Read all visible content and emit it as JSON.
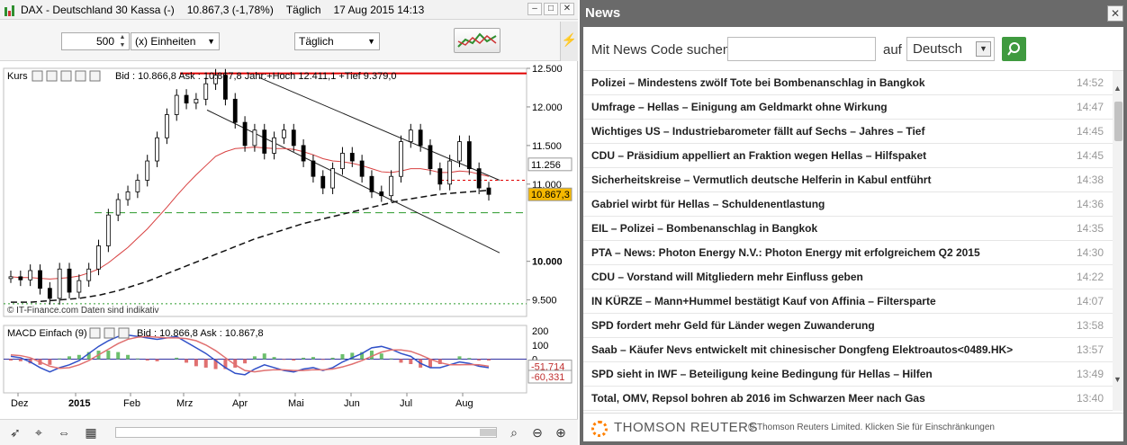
{
  "chart_window": {
    "title": "DAX - Deutschland 30 Kassa (-)",
    "last": "10.867,3 (-1,78%)",
    "interval": "Täglich",
    "datetime": "17 Aug 2015 14:13",
    "toolbar": {
      "quantity": "500",
      "unit": "(x) Einheiten",
      "period": "Täglich"
    },
    "icons": [
      "cursor-icon",
      "crosshair-icon",
      "pan-icon",
      "zoom-icon",
      "zoom-out-icon",
      "zoom-in-icon",
      "fit-icon"
    ],
    "colors": {
      "support": "#e00000",
      "ma_red": "#d84040",
      "channel": "#202020",
      "dashed_green": "#2a9a2a",
      "price_tag": "#f5b800"
    }
  },
  "chart_data": [
    {
      "type": "line",
      "title": "Kurs",
      "legend_text": "Bid : 10.866,8 Ask : 10.867,8 Jahr:+Hoch 12.411,1 +Tief 9.379,0",
      "credit": "© IT-Finance.com  Daten sind indikativ",
      "ylabels": [
        "12.500",
        "12.000",
        "11.500",
        "11.000",
        "10.000",
        "9.500"
      ],
      "ylim": [
        9379,
        12500
      ],
      "tags": [
        "11.256",
        "10.867,3"
      ],
      "xlabels": [
        "Dez",
        "2015",
        "Feb",
        "Mrz",
        "Apr",
        "Mai",
        "Jun",
        "Jul",
        "Aug"
      ],
      "year_high": 12411.1,
      "year_low": 9379.0,
      "series": [
        {
          "name": "Kurs",
          "values": [
            9800,
            9760,
            9880,
            9650,
            9520,
            9900,
            9600,
            9750,
            9900,
            10200,
            10600,
            10800,
            10900,
            11050,
            11300,
            11600,
            11900,
            12150,
            12050,
            12100,
            12300,
            12411,
            12100,
            11800,
            11500,
            11700,
            11400,
            11600,
            11700,
            11500,
            11300,
            11100,
            10950,
            11200,
            11400,
            11300,
            11100,
            10900,
            10850,
            11100,
            11550,
            11700,
            11500,
            11200,
            11000,
            11300,
            11550,
            11200,
            10950,
            10867
          ]
        },
        {
          "name": "MA",
          "values": [
            9800,
            9790,
            9790,
            9780,
            9770,
            9780,
            9790,
            9810,
            9850,
            9900,
            9980,
            10080,
            10180,
            10300,
            10420,
            10560,
            10700,
            10850,
            10990,
            11120,
            11240,
            11360,
            11420,
            11460,
            11470,
            11480,
            11470,
            11460,
            11460,
            11450,
            11420,
            11380,
            11330,
            11300,
            11290,
            11270,
            11240,
            11200,
            11160,
            11150,
            11170,
            11200,
            11200,
            11180,
            11150,
            11150,
            11170,
            11160,
            11130,
            11100
          ]
        },
        {
          "name": "MA lang",
          "values": [
            9470,
            9470,
            9470,
            9480,
            9490,
            9500,
            9510,
            9520,
            9540,
            9560,
            9590,
            9620,
            9660,
            9700,
            9740,
            9790,
            9840,
            9890,
            9940,
            9990,
            10040,
            10090,
            10140,
            10190,
            10240,
            10290,
            10330,
            10370,
            10410,
            10450,
            10490,
            10520,
            10550,
            10580,
            10610,
            10640,
            10670,
            10700,
            10730,
            10760,
            10790,
            10810,
            10830,
            10850,
            10870,
            10880,
            10890,
            10900,
            10910,
            10920
          ]
        }
      ]
    },
    {
      "type": "area",
      "title": "MACD Einfach (9)",
      "legend_text": "Bid : 10.866,8 Ask : 10.867,8",
      "ylabels": [
        "200",
        "100",
        "0"
      ],
      "tags": [
        "-51,714",
        "-60,331"
      ],
      "ylim": [
        -200,
        200
      ],
      "series": [
        {
          "name": "MACD",
          "values": [
            20,
            10,
            -20,
            -60,
            -90,
            -60,
            -40,
            -10,
            40,
            90,
            130,
            160,
            170,
            160,
            150,
            140,
            150,
            160,
            120,
            80,
            40,
            -10,
            -60,
            -100,
            -110,
            -70,
            -40,
            -60,
            -80,
            -90,
            -70,
            -60,
            -80,
            -60,
            -20,
            10,
            40,
            80,
            90,
            70,
            40,
            20,
            -30,
            -60,
            -60,
            -40,
            -20,
            -30,
            -50,
            -60
          ]
        },
        {
          "name": "Signal",
          "values": [
            30,
            25,
            10,
            -20,
            -50,
            -65,
            -60,
            -40,
            -10,
            30,
            70,
            110,
            140,
            155,
            160,
            155,
            150,
            150,
            145,
            130,
            100,
            60,
            10,
            -40,
            -80,
            -90,
            -80,
            -75,
            -75,
            -80,
            -80,
            -75,
            -75,
            -70,
            -55,
            -35,
            -10,
            20,
            50,
            65,
            65,
            55,
            30,
            0,
            -25,
            -40,
            -40,
            -38,
            -40,
            -50
          ]
        }
      ]
    }
  ],
  "news": {
    "title": "News",
    "search_label": "Mit News Code suchen",
    "search_value": "",
    "auf_label": "auf",
    "language": "Deutsch",
    "items": [
      {
        "headline": "Polizei – Mindestens zwölf Tote bei Bombenanschlag in Bangkok",
        "time": "14:52"
      },
      {
        "headline": "Umfrage – Hellas – Einigung am Geldmarkt ohne Wirkung",
        "time": "14:47"
      },
      {
        "headline": "Wichtiges US – Industriebarometer fällt auf Sechs – Jahres – Tief",
        "time": "14:45"
      },
      {
        "headline": "CDU – Präsidium appelliert an Fraktion wegen Hellas – Hilfspaket",
        "time": "14:45"
      },
      {
        "headline": "Sicherheitskreise – Vermutlich deutsche Helferin in Kabul entführt",
        "time": "14:38"
      },
      {
        "headline": "Gabriel wirbt für Hellas – Schuldenentlastung",
        "time": "14:36"
      },
      {
        "headline": "EIL – Polizei – Bombenanschlag in Bangkok",
        "time": "14:35"
      },
      {
        "headline": "PTA – News: Photon Energy N.V.: Photon Energy mit erfolgreichem Q2 2015",
        "time": "14:30"
      },
      {
        "headline": "CDU – Vorstand will Mitgliedern mehr Einfluss geben",
        "time": "14:22"
      },
      {
        "headline": "IN KÜRZE – Mann+Hummel bestätigt Kauf von Affinia – Filtersparte",
        "time": "14:07"
      },
      {
        "headline": "SPD fordert mehr Geld für Länder wegen Zuwanderung",
        "time": "13:58"
      },
      {
        "headline": "Saab – Käufer Nevs entwickelt mit chinesischer Dongfeng Elektroautos<0489.HK>",
        "time": "13:57"
      },
      {
        "headline": "SPD sieht in IWF – Beteiligung keine Bedingung für Hellas – Hilfen",
        "time": "13:49"
      },
      {
        "headline": "Total, OMV, Repsol bohren ab 2016 im Schwarzen Meer nach Gas",
        "time": "13:40"
      }
    ],
    "footer_brand": "THOMSON REUTERS",
    "footer_text": "© Thomson Reuters Limited. Klicken Sie für Einschränkungen"
  }
}
